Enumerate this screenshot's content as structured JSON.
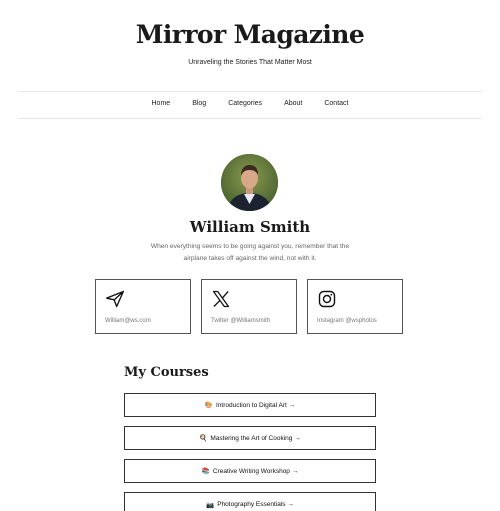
{
  "site": {
    "title": "Mirror Magazine",
    "tagline": "Unraveling the Stories That Matter Most"
  },
  "nav": {
    "items": [
      {
        "label": "Home"
      },
      {
        "label": "Blog"
      },
      {
        "label": "Categories"
      },
      {
        "label": "About"
      },
      {
        "label": "Contact"
      }
    ]
  },
  "profile": {
    "name": "William Smith",
    "bio": "When everything seems to be going against you, remember that the airplane takes off against the wind, not with it."
  },
  "social": [
    {
      "icon": "paper-plane-icon",
      "label": "William@ws.com"
    },
    {
      "icon": "x-logo-icon",
      "label": "Twitter @Williamsmith"
    },
    {
      "icon": "instagram-icon",
      "label": "Instagram @wsphotos"
    }
  ],
  "courses": {
    "title": "My Courses",
    "items": [
      {
        "emoji": "🎨",
        "label": "Introduction to Digital Art →"
      },
      {
        "emoji": "🍳",
        "label": "Mastering the Art of Cooking →"
      },
      {
        "emoji": "📚",
        "label": "Creative Writing Workshop →"
      },
      {
        "emoji": "📷",
        "label": "Photography Essentials →"
      }
    ]
  }
}
